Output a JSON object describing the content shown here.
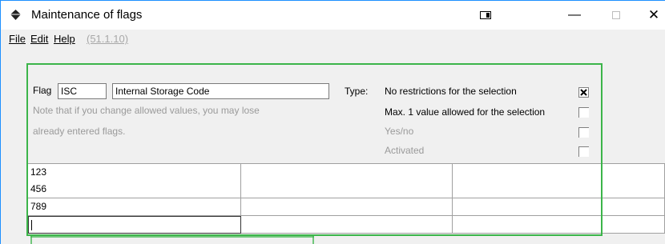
{
  "window": {
    "title": "Maintenance of flags",
    "minimize_glyph": "—",
    "close_glyph": "✕"
  },
  "menu": {
    "file": "File",
    "edit": "Edit",
    "help": "Help",
    "version": "(51.1.10)"
  },
  "form": {
    "flag_label": "Flag",
    "flag_code": "ISC",
    "flag_description": "Internal Storage Code",
    "note_line1": "Note that if you change allowed values, you may lose",
    "note_line2": "already entered flags.",
    "type_label": "Type:",
    "options": [
      {
        "label": "No restrictions for the selection",
        "checked": true,
        "enabled": true
      },
      {
        "label": "Max. 1 value allowed for the selection",
        "checked": false,
        "enabled": true
      },
      {
        "label": "Yes/no",
        "checked": false,
        "enabled": false
      },
      {
        "label": "Activated",
        "checked": false,
        "enabled": false
      }
    ]
  },
  "values_table": {
    "rows": [
      [
        "123",
        "",
        ""
      ],
      [
        "456",
        "",
        ""
      ],
      [
        "789",
        "",
        ""
      ],
      [
        "",
        "",
        ""
      ]
    ]
  },
  "colors": {
    "highlight_border": "#3cb54a",
    "window_border": "#1e90ff",
    "disabled_text": "#9a9a9a"
  }
}
